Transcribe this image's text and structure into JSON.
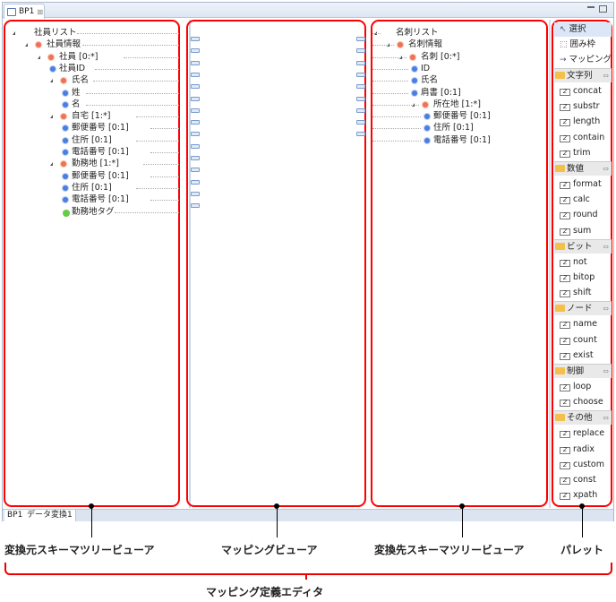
{
  "editor_tab": {
    "label": "BP1",
    "close": "⊠"
  },
  "bottom_tabs": [
    "BP1",
    "データ変換1"
  ],
  "source_tree": [
    {
      "label": "社員リスト",
      "level": 0,
      "kind": "doc",
      "expand": true
    },
    {
      "label": "社員情報",
      "level": 1,
      "kind": "o",
      "expand": true
    },
    {
      "label": "社員 [0:*]",
      "level": 2,
      "kind": "o",
      "expand": true
    },
    {
      "label": "社員ID",
      "level": 3,
      "kind": "b"
    },
    {
      "label": "氏名",
      "level": 3,
      "kind": "o",
      "expand": true
    },
    {
      "label": "姓",
      "level": 4,
      "kind": "b"
    },
    {
      "label": "名",
      "level": 4,
      "kind": "b"
    },
    {
      "label": "自宅 [1:*]",
      "level": 3,
      "kind": "o",
      "expand": true
    },
    {
      "label": "郵便番号 [0:1]",
      "level": 4,
      "kind": "b"
    },
    {
      "label": "住所 [0:1]",
      "level": 4,
      "kind": "b"
    },
    {
      "label": "電話番号 [0:1]",
      "level": 4,
      "kind": "b"
    },
    {
      "label": "勤務地 [1:*]",
      "level": 3,
      "kind": "o",
      "expand": true
    },
    {
      "label": "郵便番号 [0:1]",
      "level": 4,
      "kind": "b"
    },
    {
      "label": "住所 [0:1]",
      "level": 4,
      "kind": "b"
    },
    {
      "label": "電話番号 [0:1]",
      "level": 4,
      "kind": "b"
    },
    {
      "label": "勤務地タグ",
      "level": 4,
      "kind": "g"
    }
  ],
  "target_tree": [
    {
      "label": "名刺リスト",
      "level": 0,
      "kind": "doc",
      "expand": true
    },
    {
      "label": "名刺情報",
      "level": 1,
      "kind": "o",
      "expand": true
    },
    {
      "label": "名刺 [0:*]",
      "level": 2,
      "kind": "o",
      "expand": true
    },
    {
      "label": "ID",
      "level": 3,
      "kind": "b"
    },
    {
      "label": "氏名",
      "level": 3,
      "kind": "b"
    },
    {
      "label": "肩書 [0:1]",
      "level": 3,
      "kind": "b"
    },
    {
      "label": "所在地 [1:*]",
      "level": 3,
      "kind": "o",
      "expand": true
    },
    {
      "label": "郵便番号 [0:1]",
      "level": 4,
      "kind": "b"
    },
    {
      "label": "住所 [0:1]",
      "level": 4,
      "kind": "b"
    },
    {
      "label": "電話番号 [0:1]",
      "level": 4,
      "kind": "b"
    }
  ],
  "palette": {
    "tools": [
      {
        "label": "選択",
        "icon": "cursor-icon",
        "selected": true
      },
      {
        "label": "囲み枠",
        "icon": "marquee-icon"
      },
      {
        "label": "マッピング",
        "icon": "arrow-icon"
      }
    ],
    "groups": [
      {
        "label": "文字列",
        "items": [
          "concat",
          "substr",
          "length",
          "contain",
          "trim"
        ]
      },
      {
        "label": "数値",
        "items": [
          "format",
          "calc",
          "round",
          "sum"
        ]
      },
      {
        "label": "ビット",
        "items": [
          "not",
          "bitop",
          "shift"
        ]
      },
      {
        "label": "ノード",
        "items": [
          "name",
          "count",
          "exist"
        ]
      },
      {
        "label": "制御",
        "items": [
          "loop",
          "choose"
        ]
      },
      {
        "label": "その他",
        "items": [
          "replace",
          "radix",
          "custom",
          "const",
          "xpath"
        ]
      }
    ]
  },
  "captions": {
    "source": "変換元スキーマツリービューア",
    "mapping": "マッピングビューア",
    "target": "変換先スキーマツリービューア",
    "palette": "パレット",
    "editor": "マッピング定義エディタ"
  },
  "colors": {
    "highlight": "#ff0000"
  }
}
